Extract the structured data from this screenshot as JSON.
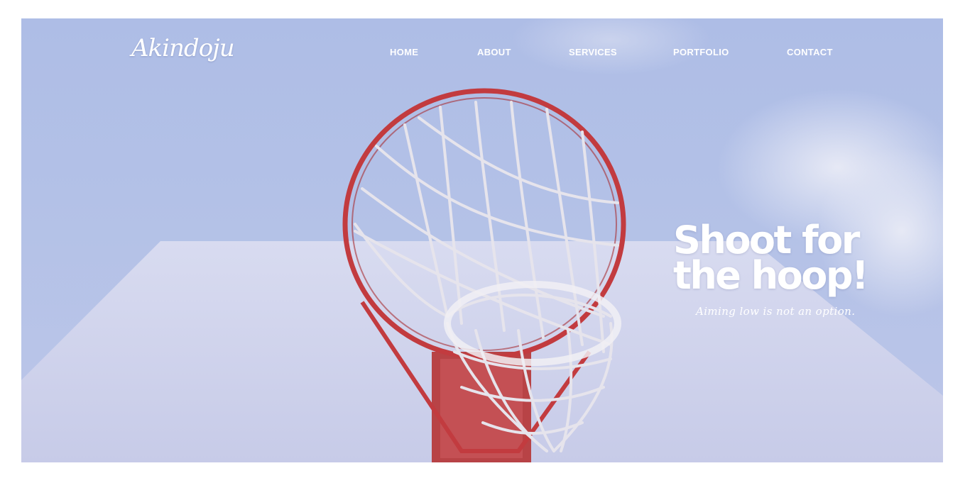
{
  "brand": {
    "logo_text": "Akindoju"
  },
  "nav": {
    "items": [
      {
        "label": "HOME"
      },
      {
        "label": "ABOUT"
      },
      {
        "label": "SERVICES"
      },
      {
        "label": "PORTFOLIO"
      },
      {
        "label": "CONTACT"
      }
    ]
  },
  "hero": {
    "headline_line1": "Shoot for",
    "headline_line2": "the hoop!",
    "tagline": "Aiming low is not an option.",
    "image": "basketball-hoop-photo"
  },
  "colors": {
    "sky": "#b0bfe8",
    "backboard": "#cfd3ec",
    "rim": "#c23b3f",
    "net": "#e8e6ee",
    "text": "#ffffff"
  }
}
